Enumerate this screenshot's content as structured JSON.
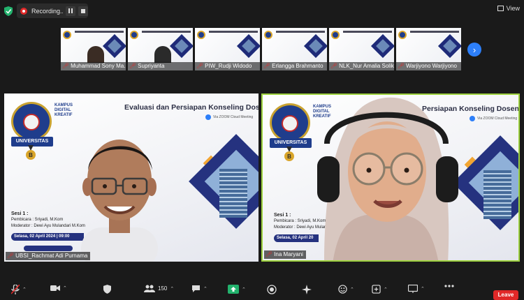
{
  "topbar": {
    "recording_label": "Recording...",
    "view_label": "View"
  },
  "colors": {
    "recording_red": "#e02828",
    "active_speaker": "#9ed23f",
    "accent_blue": "#2d7ff9",
    "leave_red": "#e02828",
    "brand_navy": "#25327f"
  },
  "thumbnails": [
    {
      "name": "Muhammad Sony Ma..."
    },
    {
      "name": "Supriyanta"
    },
    {
      "name": "PIW_Rudji Widodo"
    },
    {
      "name": "Erlangga Brahmanto"
    },
    {
      "name": "NLK_Nur Amalia Solik..."
    },
    {
      "name": "Warjiyono Warjiyono"
    }
  ],
  "slide": {
    "title": "Evaluasi dan Persiapan Konseling Dosen PA",
    "title_partial": "Persiapan Konseling Dosen PA",
    "logo_label": "UNIVERSITAS",
    "kampus_text": "KAMPUS DIGITAL KREATIF",
    "zoom_tag": "Via ZOOM Cloud Meeting",
    "sesi_heading": "Sesi 1 :",
    "pembicara": "Pembicara : Sriyadi, M.Kom",
    "moderator": "Moderator : Dewi Ayu Mulandari M.Kom",
    "date_left": "Selasa, 02 April 2024  |  09:00",
    "date_right": "Selasa, 02 April 20"
  },
  "tiles": [
    {
      "name": "UBSI_Rachmat Adi Purnama"
    },
    {
      "name": "Ina Maryani"
    }
  ],
  "toolbar": {
    "participants_count": "150",
    "leave_label": "Leave"
  }
}
